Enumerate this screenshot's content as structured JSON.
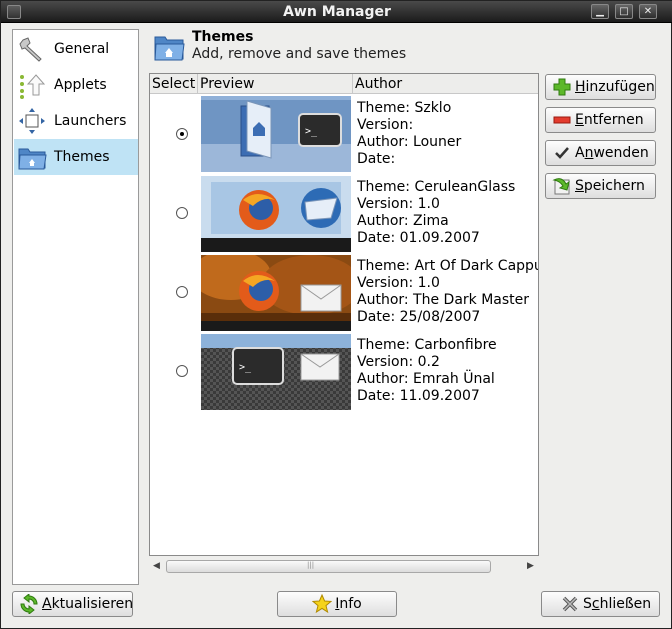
{
  "window": {
    "title": "Awn Manager"
  },
  "sidebar": {
    "items": [
      {
        "label": "General",
        "icon": "wrench-icon"
      },
      {
        "label": "Applets",
        "icon": "applets-arrow-icon"
      },
      {
        "label": "Launchers",
        "icon": "launchers-move-icon"
      },
      {
        "label": "Themes",
        "icon": "themes-folder-icon",
        "active": true
      }
    ]
  },
  "header": {
    "title": "Themes",
    "subtitle": "Add, remove and save themes"
  },
  "list": {
    "columns": [
      "Select",
      "Preview",
      "Author"
    ],
    "rows": [
      {
        "selected": true,
        "theme": "Theme: Szklo",
        "version": "Version:",
        "author": "Author: Louner",
        "date": "Date:"
      },
      {
        "selected": false,
        "theme": "Theme: CeruleanGlass",
        "version": "Version: 1.0",
        "author": "Author: Zima",
        "date": "Date: 01.09.2007"
      },
      {
        "selected": false,
        "theme": "Theme: Art Of Dark Cappuc",
        "version": "Version: 1.0",
        "author": "Author: The Dark Master",
        "date": "Date: 25/08/2007"
      },
      {
        "selected": false,
        "theme": "Theme: Carbonfibre",
        "version": "Version: 0.2",
        "author": "Author: Emrah Ünal",
        "date": "Date: 11.09.2007"
      }
    ]
  },
  "actions": {
    "add": {
      "first": "H",
      "rest": "inzufügen"
    },
    "remove": {
      "first": "E",
      "rest": "ntfernen"
    },
    "apply": {
      "pre": "A",
      "u": "n",
      "post": "wenden"
    },
    "save": {
      "first": "S",
      "rest": "peichern"
    }
  },
  "footer": {
    "refresh": {
      "first": "A",
      "rest": "ktualisieren"
    },
    "info": {
      "first": "I",
      "rest": "nfo"
    },
    "close": {
      "pre": "S",
      "u": "c",
      "post": "hließen"
    }
  },
  "colors": {
    "selection": "#bfe3f5",
    "window_bg": "#eeeeec",
    "titlebar": "#1b1b1b"
  }
}
